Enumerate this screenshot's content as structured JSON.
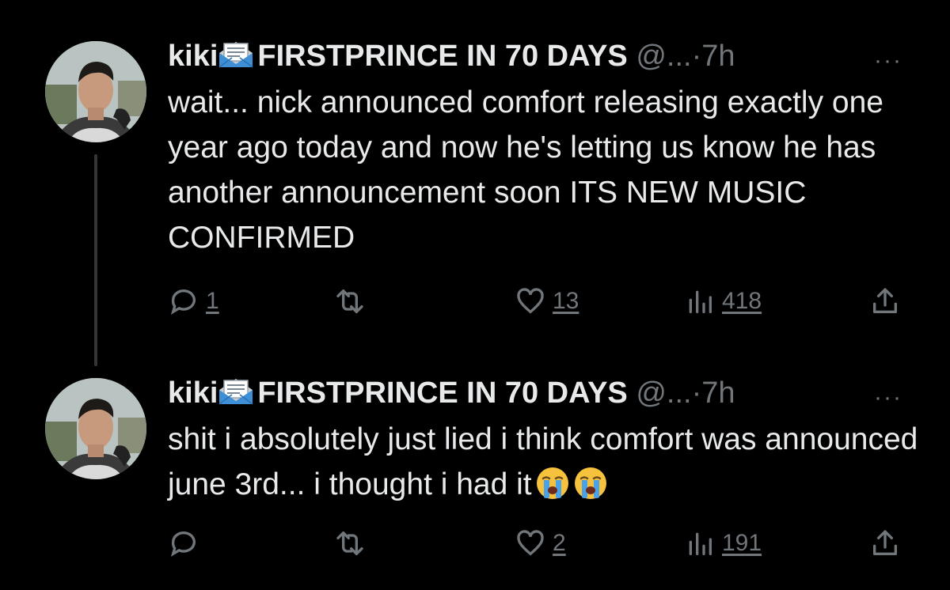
{
  "tweets": [
    {
      "display_name": "kiki",
      "display_name_suffix": "FIRSTPRINCE IN 70 DAYS",
      "handle": "@...",
      "dot": "·",
      "time": "7h",
      "more": "···",
      "text": "wait... nick announced comfort releasing exactly one year ago today and now he's letting us know he has another announcement soon ITS NEW MUSIC CONFIRMED",
      "emoji": [],
      "reply_count": "1",
      "retweet_count": "",
      "like_count": "13",
      "view_count": "418"
    },
    {
      "display_name": "kiki",
      "display_name_suffix": "FIRSTPRINCE IN 70 DAYS",
      "handle": "@...",
      "dot": "·",
      "time": "7h",
      "more": "···",
      "text": "shit i absolutely just lied i think comfort was announced june 3rd... i thought i had it",
      "emoji": [
        "loudly-crying-face",
        "loudly-crying-face"
      ],
      "reply_count": "",
      "retweet_count": "",
      "like_count": "2",
      "view_count": "191"
    }
  ],
  "colors": {
    "background": "#000000",
    "text": "#e7e9ea",
    "secondary": "#71767b",
    "thread_line": "#333639"
  },
  "icons": [
    "envelope-icon",
    "reply-icon",
    "retweet-icon",
    "like-icon",
    "views-icon",
    "share-icon",
    "more-icon"
  ]
}
